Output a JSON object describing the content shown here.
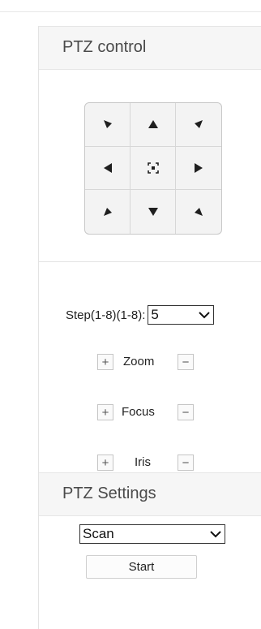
{
  "ptz_control": {
    "title": "PTZ control",
    "pad": [
      {
        "name": "up-left-icon"
      },
      {
        "name": "up-icon"
      },
      {
        "name": "up-right-icon"
      },
      {
        "name": "left-icon"
      },
      {
        "name": "center-focus-icon"
      },
      {
        "name": "right-icon"
      },
      {
        "name": "down-left-icon"
      },
      {
        "name": "down-icon"
      },
      {
        "name": "down-right-icon"
      }
    ]
  },
  "step": {
    "label": "Step(1-8)(1-8):",
    "value": "5"
  },
  "controls": [
    {
      "label": "Zoom",
      "plus": "+",
      "minus": "−"
    },
    {
      "label": "Focus",
      "plus": "+",
      "minus": "−"
    },
    {
      "label": "Iris",
      "plus": "+",
      "minus": "−"
    }
  ],
  "ptz_settings": {
    "title": "PTZ Settings",
    "mode_value": "Scan",
    "start_label": "Start"
  },
  "colors": {
    "header_bg": "#f6f6f6",
    "pad_bg": "#f3f3f3",
    "arrow": "#1f1f1f"
  }
}
